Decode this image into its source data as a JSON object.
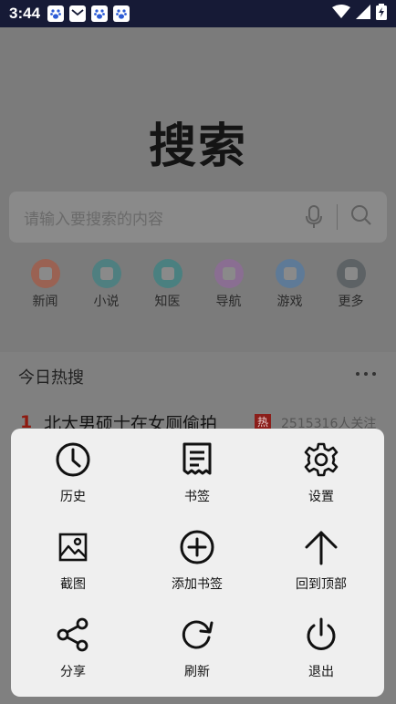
{
  "status_bar": {
    "time": "3:44",
    "notification_icons": [
      "baidu-paw-icon",
      "mail-icon",
      "baidu-paw-icon",
      "baidu-paw-icon"
    ],
    "right_icons": [
      "wifi-icon",
      "signal-icon",
      "battery-charging-icon"
    ]
  },
  "logo": "搜索",
  "search": {
    "placeholder": "请输入要搜索的内容",
    "voice_icon": "microphone-icon",
    "search_icon": "search-icon"
  },
  "quick_links": [
    {
      "label": "新闻",
      "color": "#9a6253"
    },
    {
      "label": "小说",
      "color": "#4f7f80"
    },
    {
      "label": "知医",
      "color": "#4a8080"
    },
    {
      "label": "导航",
      "color": "#8a6e92"
    },
    {
      "label": "游戏",
      "color": "#5e7a97"
    },
    {
      "label": "更多",
      "color": "#5d6265"
    }
  ],
  "hot": {
    "title": "今日热搜",
    "more_icon": "more-dots-icon",
    "items": [
      {
        "rank": "1",
        "text": "北大男硕士在女厕偷拍",
        "badge": "热",
        "count": "2515316人关注"
      }
    ]
  },
  "menu": {
    "items": [
      {
        "label": "历史",
        "icon": "history-clock-icon"
      },
      {
        "label": "书签",
        "icon": "bookmark-receipt-icon"
      },
      {
        "label": "设置",
        "icon": "gear-icon"
      },
      {
        "label": "截图",
        "icon": "screenshot-image-icon"
      },
      {
        "label": "添加书签",
        "icon": "add-circle-icon"
      },
      {
        "label": "回到顶部",
        "icon": "arrow-up-icon"
      },
      {
        "label": "分享",
        "icon": "share-icon"
      },
      {
        "label": "刷新",
        "icon": "refresh-icon"
      },
      {
        "label": "退出",
        "icon": "power-icon"
      }
    ]
  }
}
